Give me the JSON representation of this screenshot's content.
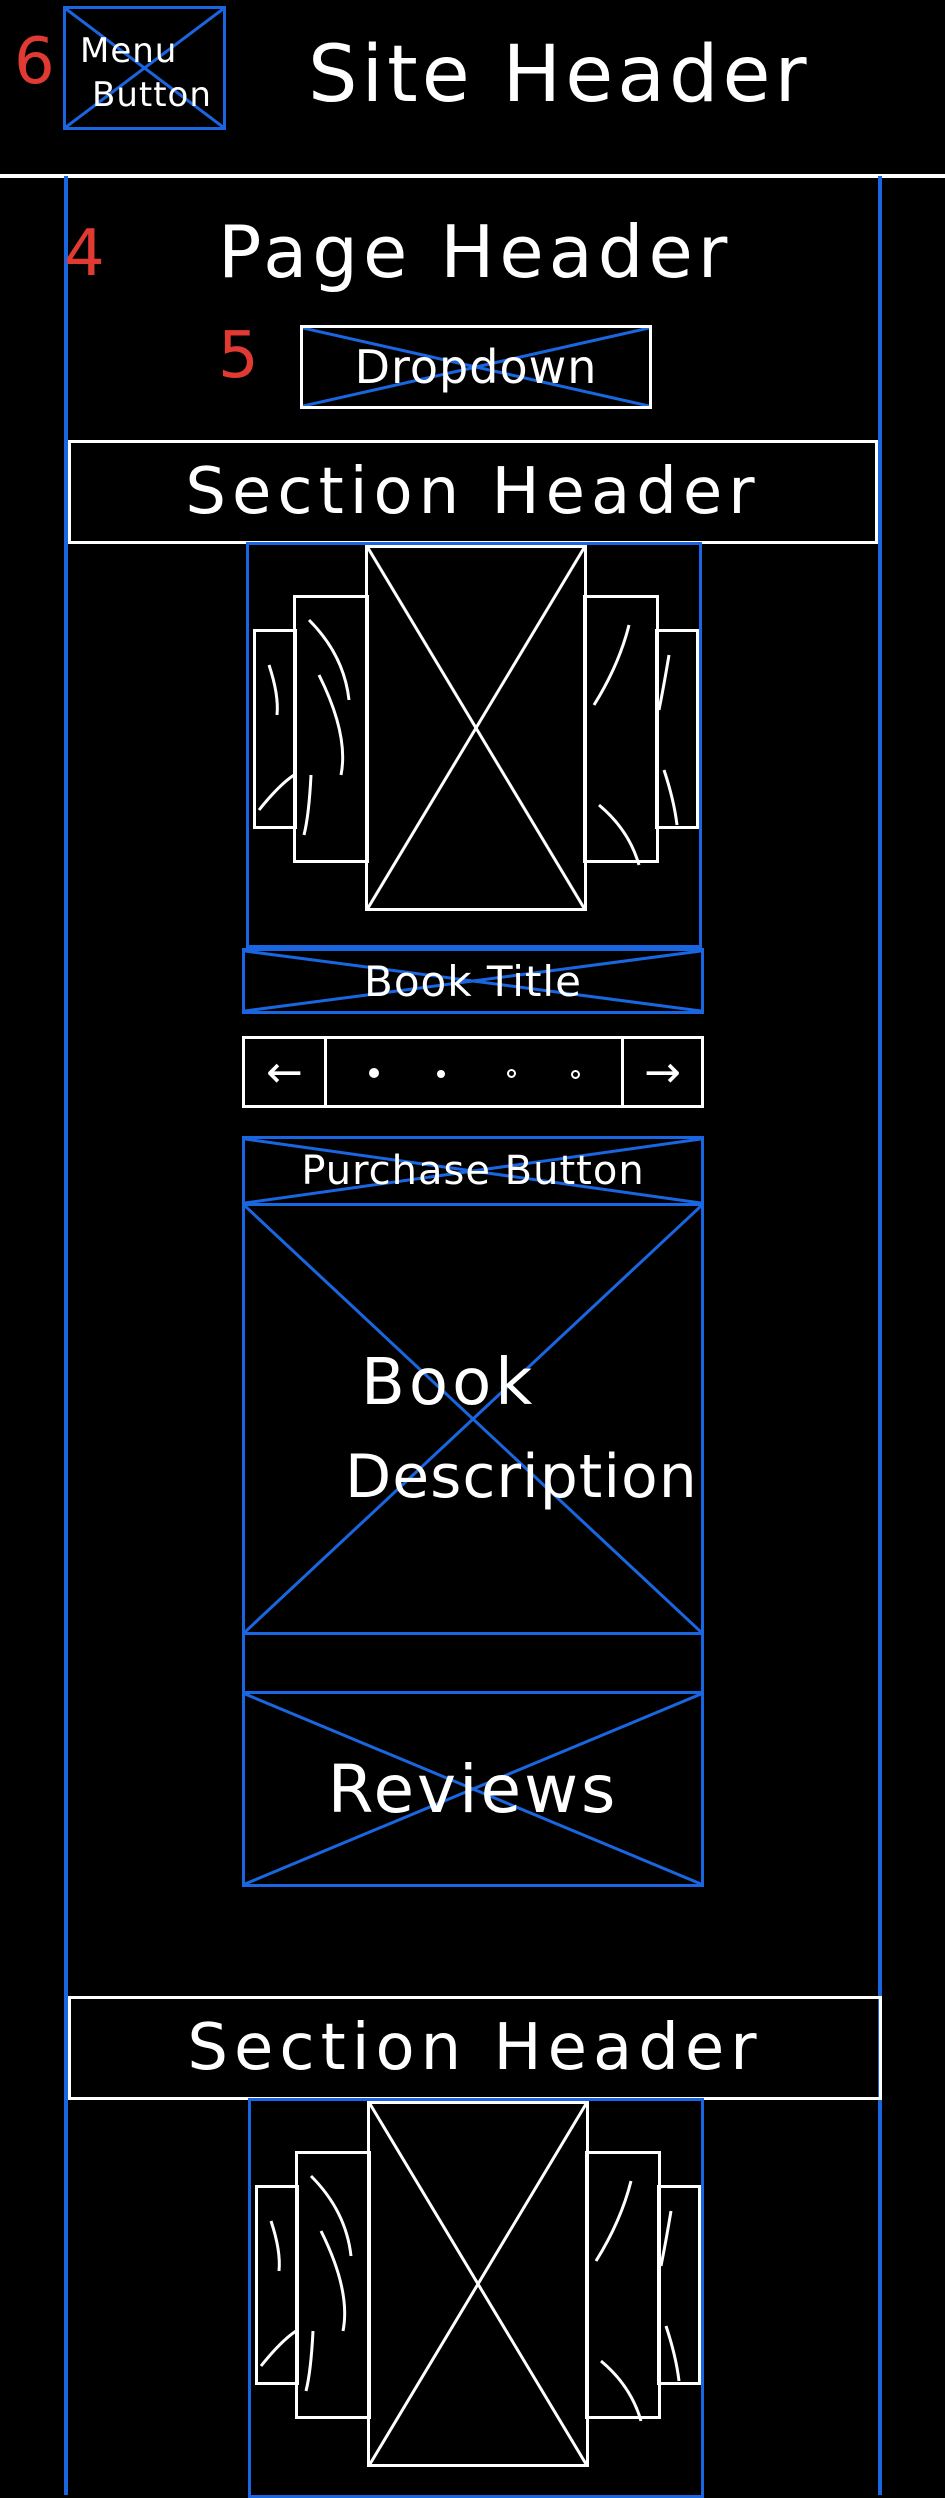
{
  "annotations": {
    "menu_marker": "6",
    "page_header_marker": "4",
    "dropdown_marker": "5"
  },
  "site": {
    "menu_button_line1": "Menu",
    "menu_button_line2": "Button",
    "site_header": "Site Header"
  },
  "page": {
    "page_header": "Page Header",
    "dropdown": "Dropdown"
  },
  "sections": [
    {
      "header": "Section Header"
    },
    {
      "header": "Section Header"
    }
  ],
  "book": {
    "title": "Book Title",
    "carousel": {
      "prev_icon": "arrow-left-icon",
      "next_icon": "arrow-right-icon",
      "dot_count": 4
    },
    "purchase_button": "Purchase Button",
    "description_line1": "Book",
    "description_line2": "Description",
    "reviews": "Reviews"
  },
  "colors": {
    "background": "#000000",
    "sketch_white": "#ffffff",
    "wireframe_blue": "#1a66e0",
    "annotation_red": "#e03a33"
  }
}
